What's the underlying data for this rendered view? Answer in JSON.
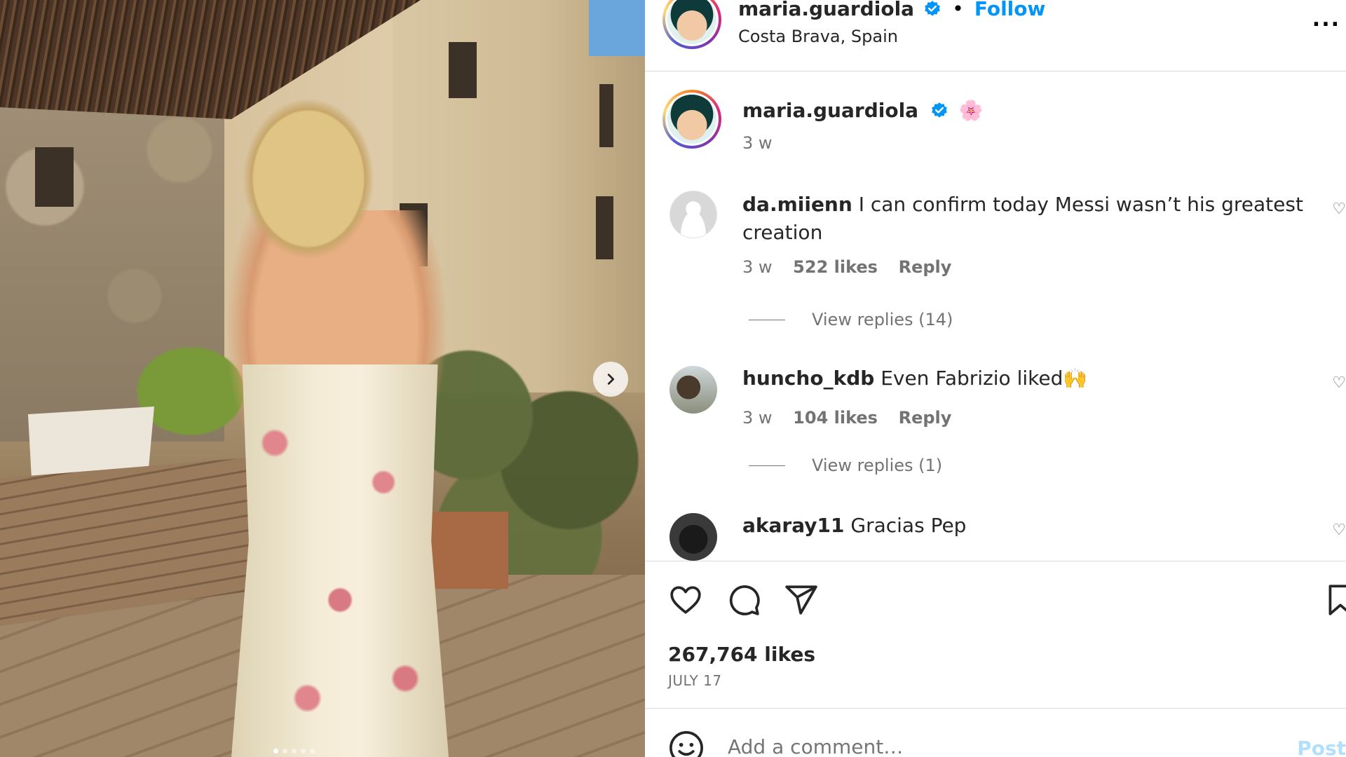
{
  "post": {
    "author": "maria.guardiola",
    "follow_label": "Follow",
    "separator": "•",
    "location": "Costa Brava, Spain",
    "more_label": "...",
    "caption_emoji": "🌸",
    "caption_time": "3 w"
  },
  "comments": [
    {
      "user": "da.miienn",
      "text": "I can confirm today Messi wasn’t his greatest creation",
      "time": "3 w",
      "likes": "522 likes",
      "reply_label": "Reply",
      "view_replies": "View replies (14)"
    },
    {
      "user": "huncho_kdb",
      "text": "Even Fabrizio liked🙌",
      "time": "3 w",
      "likes": "104 likes",
      "reply_label": "Reply",
      "view_replies": "View replies (1)"
    },
    {
      "user": "akaray11",
      "text": "Gracias Pep"
    }
  ],
  "actions": {
    "like_icon": "heart-icon",
    "comment_icon": "comment-icon",
    "share_icon": "share-icon",
    "save_icon": "bookmark-icon"
  },
  "stats": {
    "likes": "267,764 likes",
    "date": "JULY 17"
  },
  "composer": {
    "placeholder": "Add a comment…",
    "post_label": "Post"
  },
  "colors": {
    "accent": "#0095f6",
    "text_primary": "#262626",
    "text_secondary": "#737373",
    "border": "#dbdbdb"
  }
}
